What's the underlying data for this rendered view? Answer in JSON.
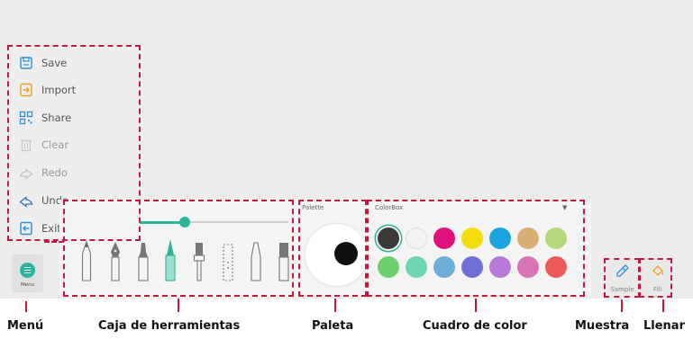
{
  "menu": {
    "items": [
      {
        "label": "Save",
        "icon": "save-icon"
      },
      {
        "label": "Import",
        "icon": "import-icon"
      },
      {
        "label": "Share",
        "icon": "share-icon"
      },
      {
        "label": "Clear",
        "icon": "clear-icon"
      },
      {
        "label": "Redo",
        "icon": "redo-icon"
      },
      {
        "label": "Undo",
        "icon": "undo-icon"
      },
      {
        "label": "Exit",
        "icon": "exit-icon"
      }
    ],
    "button_label": "Menu"
  },
  "toolbox": {
    "brush_size_fraction": 0.3,
    "tools": [
      "pencil-icon",
      "fountain-pen-icon",
      "marker-icon",
      "highlighter-icon",
      "brush-icon",
      "eraser-block-icon",
      "calligraphy-pen-icon",
      "crayon-icon"
    ]
  },
  "palette": {
    "label": "Palette",
    "current_color": "#111111"
  },
  "colorbox": {
    "label": "ColorBox",
    "caret": "▼",
    "colors": [
      "#3a3a3a",
      "#f2f2f2",
      "#e0137e",
      "#f2dc0d",
      "#19a5e0",
      "#d8af72",
      "#b3d87a",
      "#6fcf6f",
      "#6fd4b4",
      "#6caed8",
      "#6f6fd8",
      "#b77ad8",
      "#d873b4",
      "#ef5a5a"
    ],
    "selected_index": 0
  },
  "sample": {
    "label": "Sample"
  },
  "fill": {
    "label": "Fill"
  },
  "captions": {
    "menu": "Menú",
    "toolbox": "Caja de herramientas",
    "palette": "Paleta",
    "colorbox": "Cuadro de color",
    "sample": "Muestra",
    "fill": "Llenar"
  },
  "colors": {
    "accent": "#2bb59a",
    "callout": "#c4193f"
  }
}
